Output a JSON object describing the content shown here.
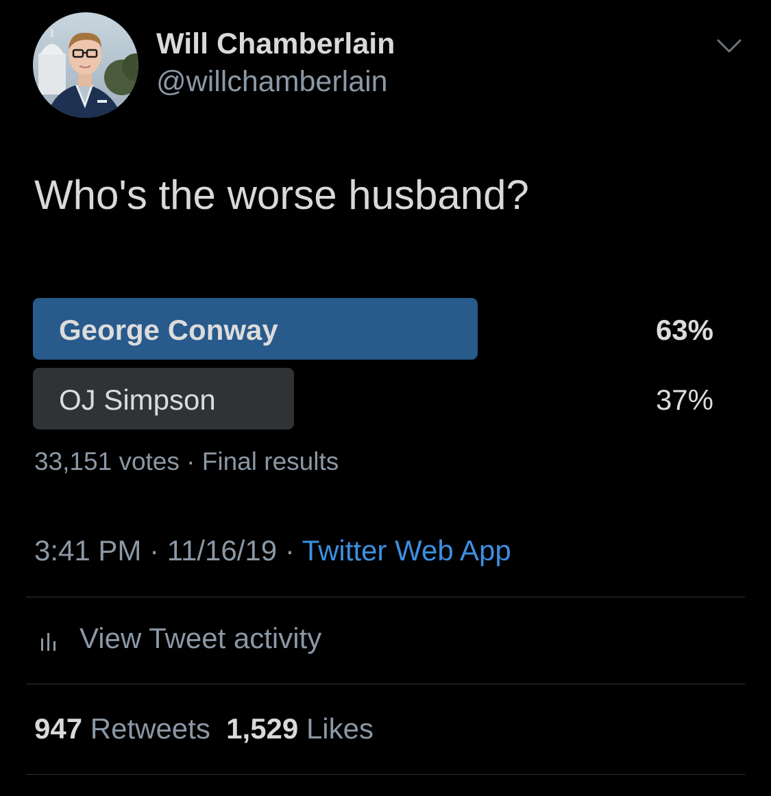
{
  "author": {
    "display_name": "Will Chamberlain",
    "handle": "@willchamberlain"
  },
  "tweet": {
    "text": "Who's the worse husband?"
  },
  "poll": {
    "options": [
      {
        "label": "George Conway",
        "percent_text": "63%",
        "percent": 63,
        "winner": true
      },
      {
        "label": "OJ Simpson",
        "percent_text": "37%",
        "percent": 37,
        "winner": false
      }
    ],
    "votes": "33,151 votes",
    "separator": "·",
    "status": "Final results"
  },
  "meta": {
    "time": "3:41 PM",
    "separator": "·",
    "date": "11/16/19",
    "source": "Twitter Web App"
  },
  "activity": {
    "label": "View Tweet activity",
    "icon": "bar-chart-icon"
  },
  "stats": {
    "retweets_count": "947",
    "retweets_label": "Retweets",
    "likes_count": "1,529",
    "likes_label": "Likes"
  },
  "colors": {
    "background": "#000000",
    "winner_bar": "#285a8b",
    "loser_bar": "#2f3336",
    "link": "#3d8fe0",
    "secondary_text": "#8b98a5"
  }
}
